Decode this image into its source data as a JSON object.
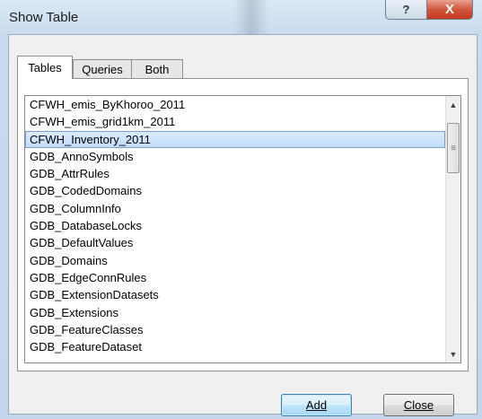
{
  "window": {
    "title": "Show Table",
    "help_glyph": "?",
    "close_glyph": "X"
  },
  "tabs": [
    {
      "label": "Tables",
      "active": true
    },
    {
      "label": "Queries",
      "active": false
    },
    {
      "label": "Both",
      "active": false
    }
  ],
  "list": {
    "items": [
      "CFWH_emis_ByKhoroo_2011",
      "CFWH_emis_grid1km_2011",
      "CFWH_Inventory_2011",
      "GDB_AnnoSymbols",
      "GDB_AttrRules",
      "GDB_CodedDomains",
      "GDB_ColumnInfo",
      "GDB_DatabaseLocks",
      "GDB_DefaultValues",
      "GDB_Domains",
      "GDB_EdgeConnRules",
      "GDB_ExtensionDatasets",
      "GDB_Extensions",
      "GDB_FeatureClasses",
      "GDB_FeatureDataset"
    ],
    "selected_index": 2
  },
  "scrollbar": {
    "up_glyph": "▲",
    "down_glyph": "▼",
    "grip_glyph": "≡"
  },
  "buttons": {
    "add_label": "Add",
    "close_label": "Close"
  }
}
